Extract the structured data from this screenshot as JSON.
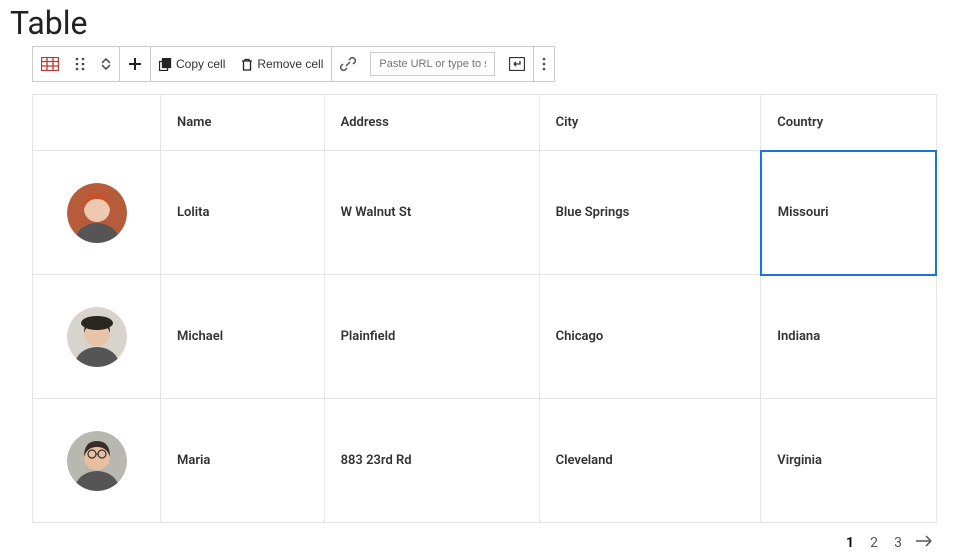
{
  "title": "Table",
  "toolbar": {
    "copy_cell_label": "Copy cell",
    "remove_cell_label": "Remove cell",
    "url_placeholder": "Paste URL or type to search"
  },
  "table": {
    "headers": {
      "name": "Name",
      "address": "Address",
      "city": "City",
      "country": "Country"
    },
    "rows": [
      {
        "name": "Lolita",
        "address": "W Walnut St",
        "city": "Blue Springs",
        "country": "Missouri",
        "avatar_bg": "#b65c3a",
        "avatar_hair": "#c8522a",
        "avatar_skin": "#eec8b1"
      },
      {
        "name": "Michael",
        "address": "Plainfield",
        "city": "Chicago",
        "country": "Indiana",
        "avatar_bg": "#d8d3cc",
        "avatar_hair": "#2a2620",
        "avatar_skin": "#e8c5a8"
      },
      {
        "name": "Maria",
        "address": "883 23rd Rd",
        "city": "Cleveland",
        "country": "Virginia",
        "avatar_bg": "#b8b8b0",
        "avatar_hair": "#3a2a28",
        "avatar_skin": "#e8c0a0"
      }
    ],
    "selected_cell": {
      "row": 0,
      "col": "country"
    }
  },
  "pagination": {
    "pages": [
      "1",
      "2",
      "3"
    ],
    "current": 0
  }
}
